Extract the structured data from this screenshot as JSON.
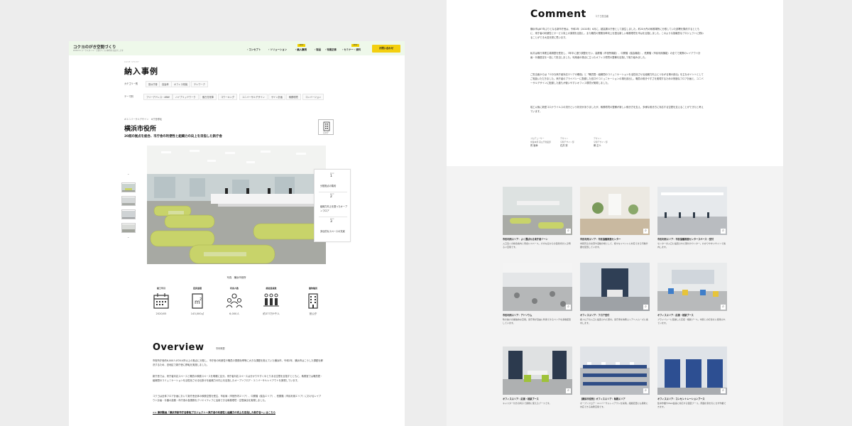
{
  "header": {
    "brand": "コクヨのがき空間づくり",
    "brand_sub": "KOKUYO ワークスタイル・空間づくりの事例をお届けします",
    "nav": [
      "・コンセプト",
      "・ソリューション",
      "・納入事例",
      "・製品",
      "・特集記事",
      "・セミナー・資料"
    ],
    "nav_badge": "NEW",
    "contact": "お問い合わせ"
  },
  "page": {
    "title_en": "CASE STUDY",
    "title": "納入事例"
  },
  "filters": {
    "row1": [
      "カテゴリー別",
      "官公庁舎",
      "自治体",
      "オフィス改装",
      "テレワーク"
    ],
    "row2": [
      "テーマ別",
      "フリーアドレス・ABW",
      "ハイブリッドワーク",
      "働き方改革",
      "コワーキング",
      "ユニバーサルデザイン",
      "サイン計画",
      "執務環境",
      "コンバージョン"
    ]
  },
  "project": {
    "crumb": "#ユニバーサルデザイン　#庁舎移転",
    "title": "横浜市役所",
    "subtitle": "20超の拠点を統合、市庁舎の利便性と組織力の向上を目指した新庁舎",
    "building_label": "官公庁",
    "caption": "写真　横浜市役所"
  },
  "steps": [
    {
      "label": "Point",
      "num": "1",
      "text": "分散拠点の集約"
    },
    {
      "label": "Point",
      "num": "2",
      "text": "組織力向上を図ったオープンフロア"
    },
    {
      "label": "Point",
      "num": "3",
      "text": "多目的なスペースの充実"
    }
  ],
  "facts": [
    {
      "label": "竣工年月",
      "icon": "calendar-icon",
      "value": "2020/05"
    },
    {
      "label": "延床面積",
      "icon": "area-icon",
      "value": "143,000㎡"
    },
    {
      "label": "利用人数",
      "icon": "people-icon",
      "value": "6,000人"
    },
    {
      "label": "総従業員数",
      "icon": "staff-icon",
      "value": "約377万9千人"
    },
    {
      "label": "建物種別",
      "icon": "building-icon",
      "value": "官公庁"
    }
  ],
  "overview": {
    "title": "Overview",
    "subtitle": "事例概要",
    "paragraphs": [
      "市役所庁舎約6,000人が20カ所以上の拠点に分散し、市庁舎の利便性や職員の業務効率等に大きな課題を抱えていた横浜市。令和2年、横浜市はこうした課題を解決するため、旧地区で新庁舎に移転を実施しました。",
      "新庁舎では、来庁者対応スペースと職員の執務スペースを明確に区分。来庁者対応スペースは分かりやすくゆとりある空間を目指すとともに、執務室では職員間・組織間のコミュニケーションを活性化させる仕掛けを組織力の向上を目指したオープンフロア・ユニバーサルレイアウトを実現しています。",
      "コクヨは全体フロア計画において新庁舎全体の執務空間を受注、市民局（市役所内エリア）、中層階（議会エリア）、低層階（市民利用エリア）におけるレイアウト計画・什器の設置・市庁舎の各業務をクリエイティブに活用できる執務環境・空間演出を実現しました。"
    ],
    "link": ">> 事例動画「横浜市新市庁舎移転プロジェクト〜来庁者の利便性と組織力の向上を目指した新庁舎〜」はこちら"
  },
  "comment": {
    "title": "Comment",
    "subtitle": "コクヨ担当者",
    "paragraphs": [
      "横浜市は67年ぶりとなる新市庁舎は、令和2年（2020年）6月に、超高層の庁舎として誕生しました。約20カ所の執務場所に分散していた部署を集約するとともに、来庁者の利便性とサービス向上の実現を目指し、また職員の業務効率向上を図る新しい執務環境を市はを目指しました。このような挑戦的なプロジェクトに関わることができ大変光栄に思います。",
      "私共は執行事業主導調整を受託し、3年半に渡り調整を行い、高層階（市役所機能）、中層階（議会機能）、低層階（市民利用機能）の全てで実際のレイアウト計画・什器選定を一括して担当しました。利用者の視点に立ったオフィス環境の整備を目指して取り組みました。",
      "ご担当者からは「十分な来庁者対応エリアの確保」と「職員間・組織間のコミュニケーションを活性化させる組織力向上につながる場の創出」を主なポイントとしてご相談いただきました。来庁者のプライバシーに配慮した窓口やコミュニケーションの場を創出し、職員の働きやすさを実現するための快適なフロア計画と、ユニバーサルデザインに配慮した誰もが使いやすいオフィス環境が実現しました。",
      "竣工以後に新型コロナウイルスの流行という状況がありましたが、執務環境の整備が新しい働き方を支え、多様な働き方に対応する空間を支えることができたと考えています。"
    ],
    "staff": [
      {
        "role": "プロデューサー",
        "dept": "営業本部 官公庁営業部",
        "name": "荒 裕幸"
      },
      {
        "role": "デザイン",
        "dept": "空間デザイン部",
        "name": "石井 崇"
      },
      {
        "role": "デザイン",
        "dept": "空間デザイン部",
        "name": "菅 正人"
      }
    ]
  },
  "gallery": [
    {
      "title": "市民利用エリア：よく選ばれる来庁者ゾーン",
      "desc": "入口近くの総合案内と待合いスペース。大きな窓からの自然光が入る明るい空間です。"
    },
    {
      "title": "市民利用エリア：市民協働推進センター",
      "desc": "市民同士の交流や活動の場として、様々なイベントに対応できる可動什器を配置しています。"
    },
    {
      "title": "市民利用エリア：市民協働推進センタースペース・受付",
      "desc": "センターの入口に設置された受付カウンター。わかりやすいサインで案内します。"
    },
    {
      "title": "市民利用エリア：アトリウム",
      "desc": "吹き抜けの開放的な空間。来庁者が自由に利用できるベンチを多数配置しています。"
    },
    {
      "title": "オフィスエリア：フロア受付",
      "desc": "各フロアの入口に設置された受付。来庁者を執務エリアへスムーズに案内します。"
    },
    {
      "title": "オフィスエリア：応接・相談ブース",
      "desc": "プライバシーに配慮した応接・相談ブース。市民との打合せに使用されています。"
    },
    {
      "title": "オフィスエリア：応接・相談ブース",
      "desc": "キャスター付きの椅子で柔軟に使えるブースです。"
    },
    {
      "title": "【横浜市役所】オフィスエリア：執務エリア",
      "desc": "オープンフロア・ユニバーサルレイアウトを採用。組織変更にも柔軟に対応できる執務空間です。"
    },
    {
      "title": "オフィスエリア：コンセントレーションブース",
      "desc": "集中作業やWeb会議に対応する個室ブース。周囲の音を気にせず作業できます。"
    }
  ]
}
